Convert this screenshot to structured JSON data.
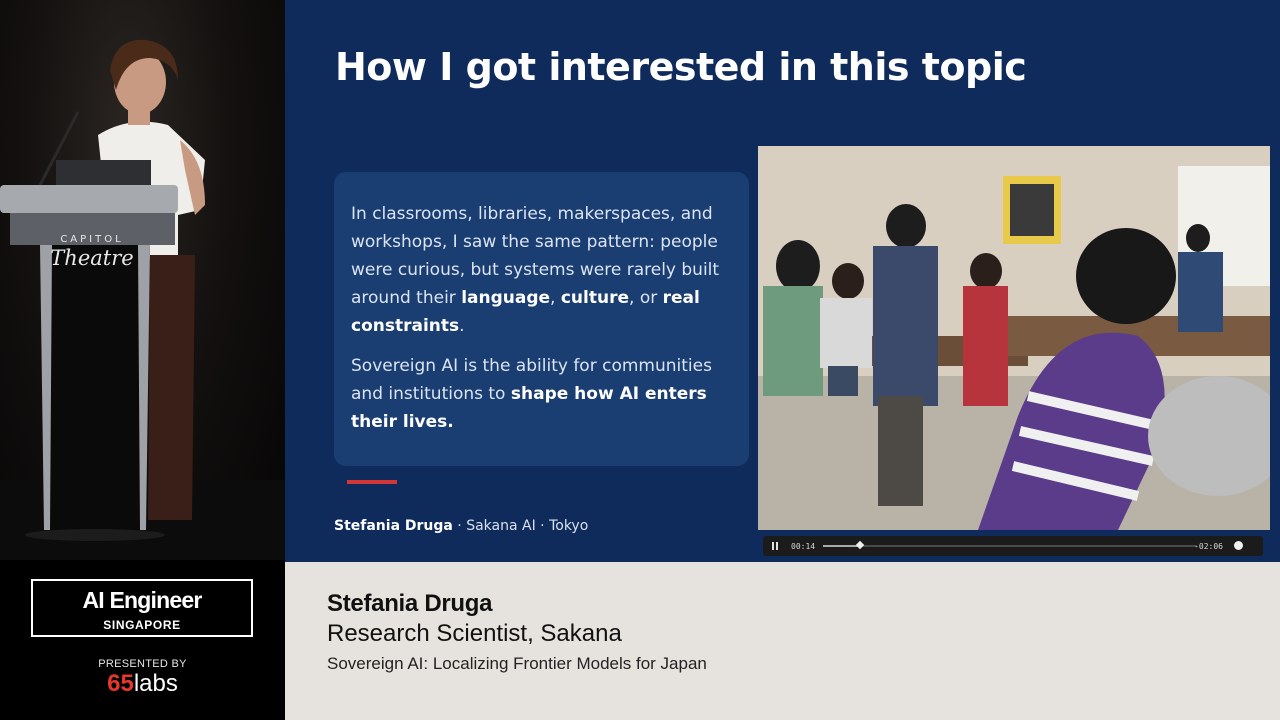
{
  "camera": {
    "podium_line1": "CAPITOL",
    "podium_line2": "Theatre"
  },
  "slide": {
    "title": "How I got interested in this topic",
    "paragraph1": {
      "lead": "In classrooms, libraries, makerspaces, and workshops, I saw the same pattern: people were curious, but systems were rarely built around their ",
      "bold1": "language",
      "sep1": ", ",
      "bold2": "culture",
      "sep2": ", or ",
      "bold3": "real constraints",
      "end": "."
    },
    "paragraph2": {
      "lead": "Sovereign AI is the ability for communities and institutions to ",
      "bold": "shape how AI enters their lives."
    },
    "footer": {
      "speaker": "Stefania Druga",
      "rest": " · Sakana AI · Tokyo"
    },
    "accent_color": "#d23636",
    "background_color": "#0f2b5b"
  },
  "video": {
    "elapsed": "00:14",
    "remaining": "-02:06",
    "progress": 0.1
  },
  "branding": {
    "event_name": "AI Engineer",
    "event_location": "SINGAPORE",
    "presented_by": "PRESENTED BY",
    "sponsor_number": "65",
    "sponsor_word": "labs",
    "sponsor_color": "#e7372d"
  },
  "lower_third": {
    "name": "Stefania Druga",
    "role": "Research Scientist, Sakana",
    "talk": "Sovereign AI: Localizing Frontier Models for Japan"
  }
}
